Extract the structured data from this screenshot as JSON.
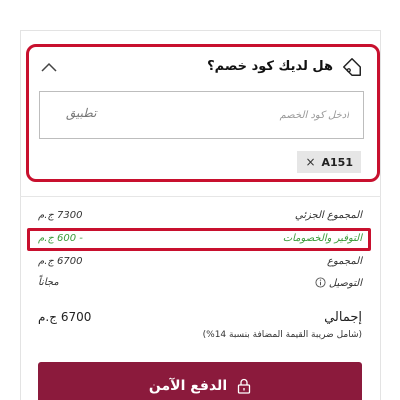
{
  "promo": {
    "title": "هل لديك كود خصم؟",
    "placeholder": "ادخل كود الخصم",
    "apply_label": "تطبيق",
    "applied_code": "A151",
    "remove_symbol": "×"
  },
  "summary": {
    "subtotal_label": "المجموع الجزئي",
    "subtotal_value": "7300 ج.م",
    "discount_label": "التوفير والخصومات",
    "discount_value": "- 600 ج.م",
    "total_label": "المجموع",
    "total_value": "6700 ج.م",
    "delivery_label": "التوصيل",
    "delivery_value": "مجاناً"
  },
  "grand": {
    "label": "إجمالي",
    "value": "6700 ج.م",
    "vat_note": "(شامل ضريبة القيمة المضافة بنسبة 14%)"
  },
  "checkout": {
    "label": "الدفع الآمن"
  },
  "colors": {
    "accent": "#8b1a3c",
    "highlight": "#c8102e",
    "savings": "#3a9b3a"
  },
  "icons": {
    "tag": "tag-icon",
    "chevron": "chevron-up-icon",
    "info": "info-icon",
    "lock": "lock-icon"
  }
}
